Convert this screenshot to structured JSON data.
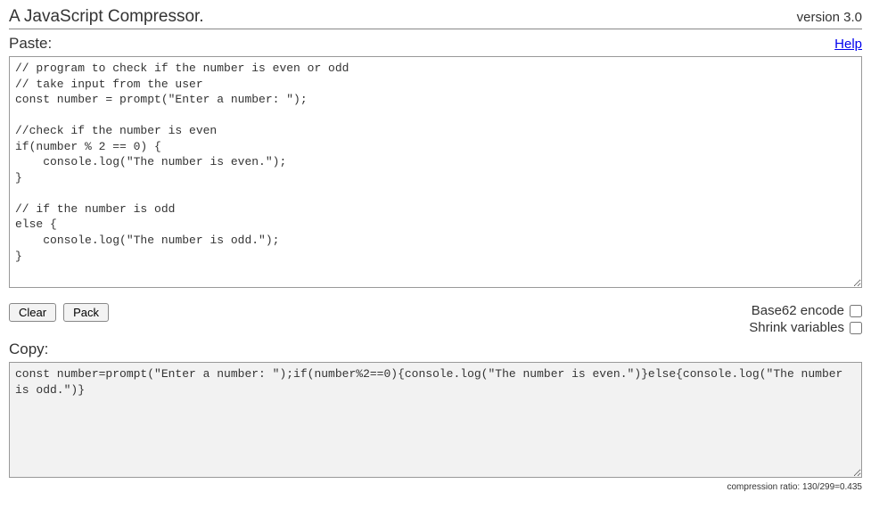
{
  "header": {
    "title": "A JavaScript Compressor.",
    "version": "version 3.0"
  },
  "paste": {
    "label": "Paste:",
    "help_label": "Help"
  },
  "input_code": "// program to check if the number is even or odd\n// take input from the user\nconst number = prompt(\"Enter a number: \");\n\n//check if the number is even\nif(number % 2 == 0) {\n    console.log(\"The number is even.\");\n}\n\n// if the number is odd\nelse {\n    console.log(\"The number is odd.\");\n}",
  "controls": {
    "clear_label": "Clear",
    "pack_label": "Pack"
  },
  "options": {
    "base62_label": "Base62 encode",
    "shrink_label": "Shrink variables"
  },
  "copy": {
    "label": "Copy:"
  },
  "output_code": "const number=prompt(\"Enter a number: \");if(number%2==0){console.log(\"The number is even.\")}else{console.log(\"The number is odd.\")}",
  "ratio_text": "compression ratio: 130/299=0.435"
}
